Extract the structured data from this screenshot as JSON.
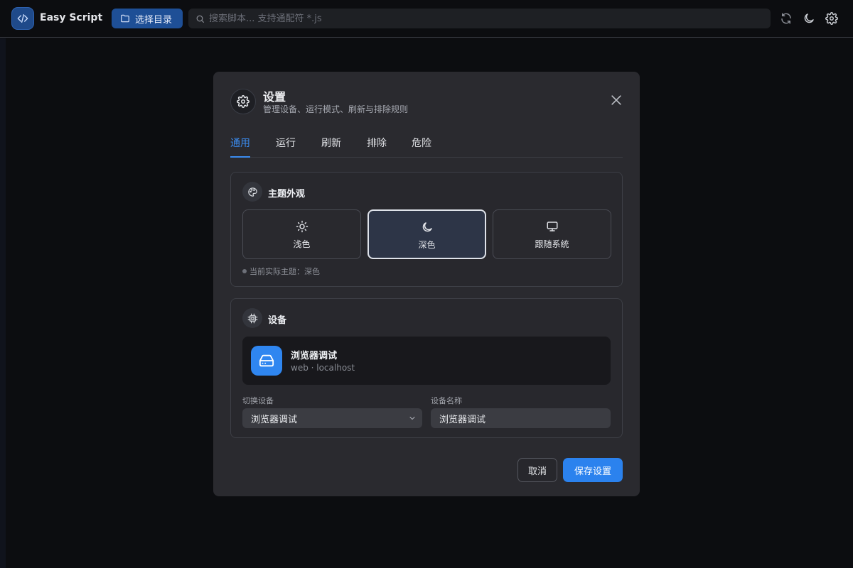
{
  "app": {
    "title": "Easy Script"
  },
  "toolbar": {
    "choose_dir_label": "选择目录",
    "search_placeholder": "搜索脚本... 支持通配符 *.js",
    "icons": [
      "refresh-icon",
      "moon-icon",
      "gear-icon"
    ]
  },
  "modal": {
    "title": "设置",
    "subtitle": "管理设备、运行模式、刷新与排除规则",
    "tabs": [
      {
        "label": "通用",
        "active": true
      },
      {
        "label": "运行",
        "active": false
      },
      {
        "label": "刷新",
        "active": false
      },
      {
        "label": "排除",
        "active": false
      },
      {
        "label": "危险",
        "active": false
      }
    ],
    "theme": {
      "title": "主题外观",
      "options": [
        {
          "label": "浅色",
          "icon": "sun-icon",
          "selected": false
        },
        {
          "label": "深色",
          "icon": "moon-icon",
          "selected": true
        },
        {
          "label": "跟随系统",
          "icon": "monitor-icon",
          "selected": false
        }
      ],
      "status": "当前实际主题：深色"
    },
    "device": {
      "title": "设备",
      "current_name": "浏览器调试",
      "current_sub": "web · localhost",
      "switch_label": "切换设备",
      "switch_value": "浏览器调试",
      "name_label": "设备名称",
      "name_value": "浏览器调试"
    },
    "cancel_label": "取消",
    "save_label": "保存设置"
  },
  "colors": {
    "accent": "#2b82ee",
    "active_tab": "#3b8cf0",
    "background": "#0c0d10",
    "modal": "#2a2a2f"
  }
}
